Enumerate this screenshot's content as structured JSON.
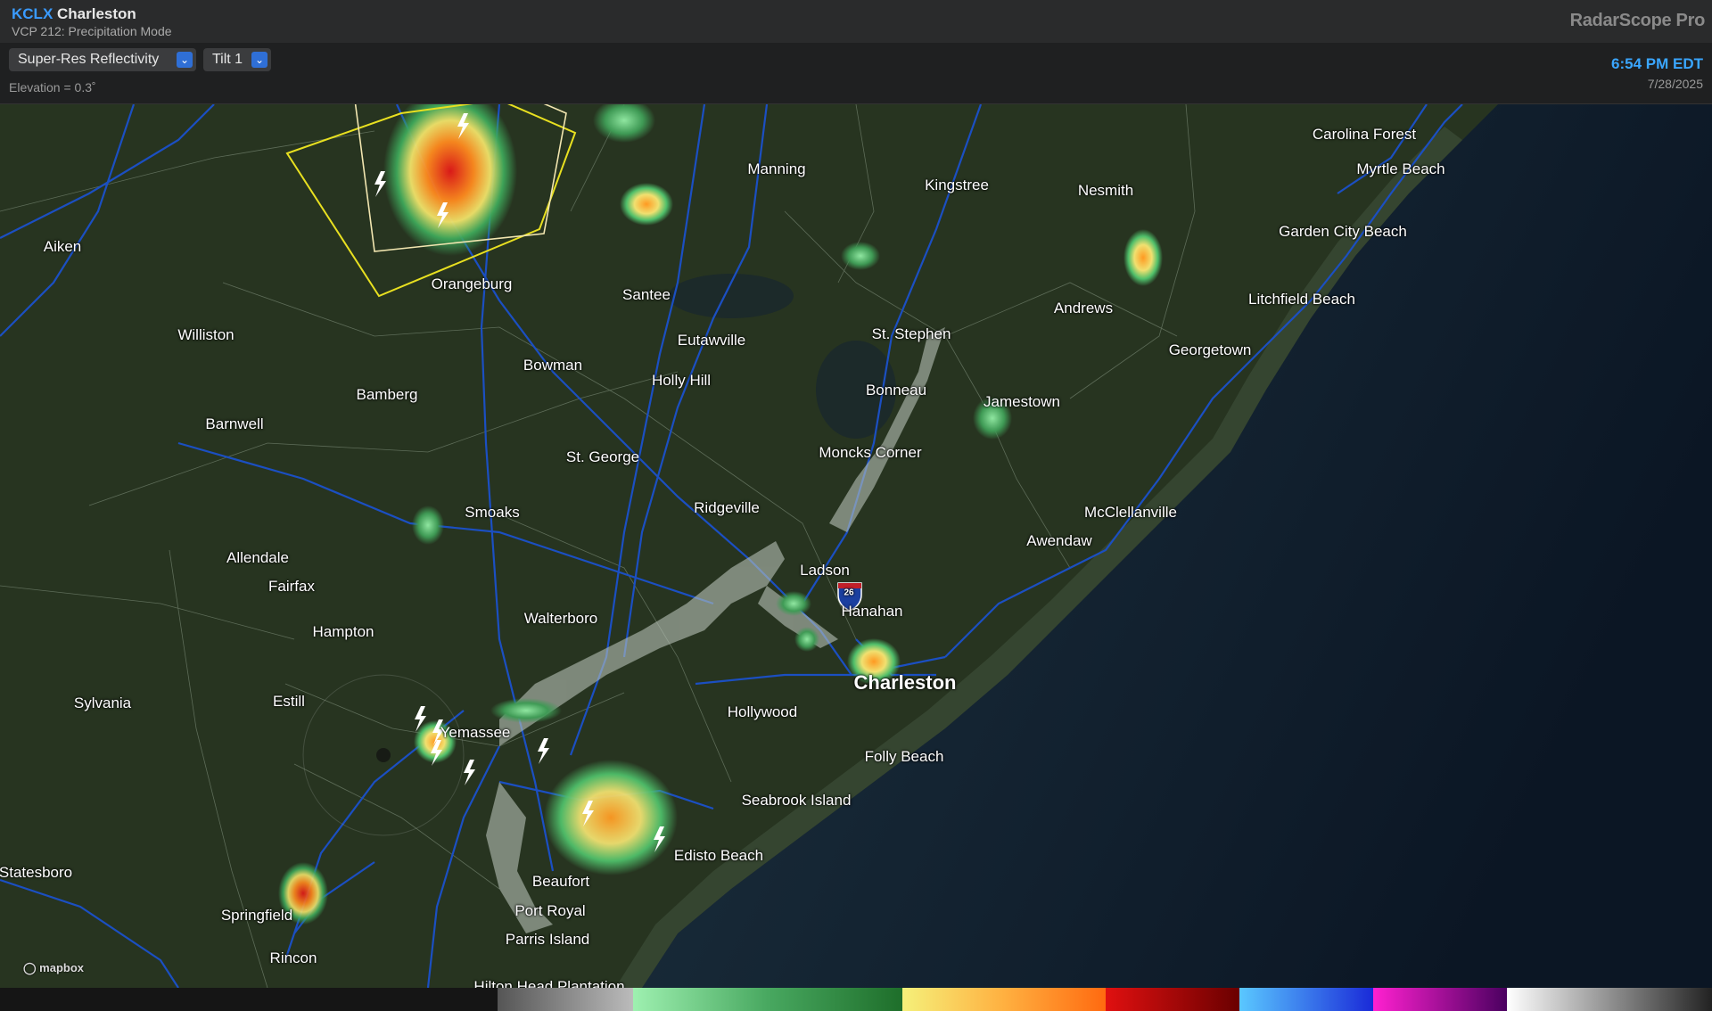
{
  "header": {
    "station_code": "KCLX",
    "station_name": "Charleston",
    "vcp": "VCP 212: Precipitation Mode",
    "brand": "RadarScope Pro"
  },
  "toolbar": {
    "product": "Super-Res Reflectivity",
    "tilt": "Tilt 1",
    "elevation": "Elevation = 0.3˚",
    "time": "6:54 PM EDT",
    "date": "7/28/2025"
  },
  "map": {
    "attribution": "mapbox",
    "interstate_shield": "26",
    "cities": {
      "carolina_forest": "Carolina Forest",
      "myrtle_beach": "Myrtle Beach",
      "manning": "Manning",
      "kingstree": "Kingstree",
      "nesmith": "Nesmith",
      "garden_city_beach": "Garden City Beach",
      "aiken": "Aiken",
      "orangeburg": "Orangeburg",
      "santee": "Santee",
      "andrews": "Andrews",
      "litchfield_beach": "Litchfield Beach",
      "williston": "Williston",
      "eutawville": "Eutawville",
      "st_stephen": "St. Stephen",
      "georgetown": "Georgetown",
      "bowman": "Bowman",
      "holly_hill": "Holly Hill",
      "bamberg": "Bamberg",
      "bonneau": "Bonneau",
      "jamestown": "Jamestown",
      "barnwell": "Barnwell",
      "moncks_corner": "Moncks Corner",
      "st_george": "St. George",
      "ridgeville": "Ridgeville",
      "smoaks": "Smoaks",
      "mcclellanville": "McClellanville",
      "awendaw": "Awendaw",
      "allendale": "Allendale",
      "ladson": "Ladson",
      "fairfax": "Fairfax",
      "hanahan": "Hanahan",
      "walterboro": "Walterboro",
      "hampton": "Hampton",
      "charleston": "Charleston",
      "sylvania": "Sylvania",
      "estill": "Estill",
      "hollywood": "Hollywood",
      "yemassee": "Yemassee",
      "folly_beach": "Folly Beach",
      "seabrook_island": "Seabrook Island",
      "edisto_beach": "Edisto Beach",
      "statesboro": "Statesboro",
      "beaufort": "Beaufort",
      "port_royal": "Port Royal",
      "springfield": "Springfield",
      "parris_island": "Parris Island",
      "rincon": "Rincon",
      "hilton_head": "Hilton Head Plantation"
    }
  },
  "legend_colors": [
    "#888888",
    "#9ef0b0",
    "#1e6e2a",
    "#f5f07a",
    "#ff8a1e",
    "#e01010",
    "#6a0000",
    "#5ac8ff",
    "#1a2ad8",
    "#ff20d0",
    "#4a0060",
    "#ffffff",
    "#222222"
  ]
}
